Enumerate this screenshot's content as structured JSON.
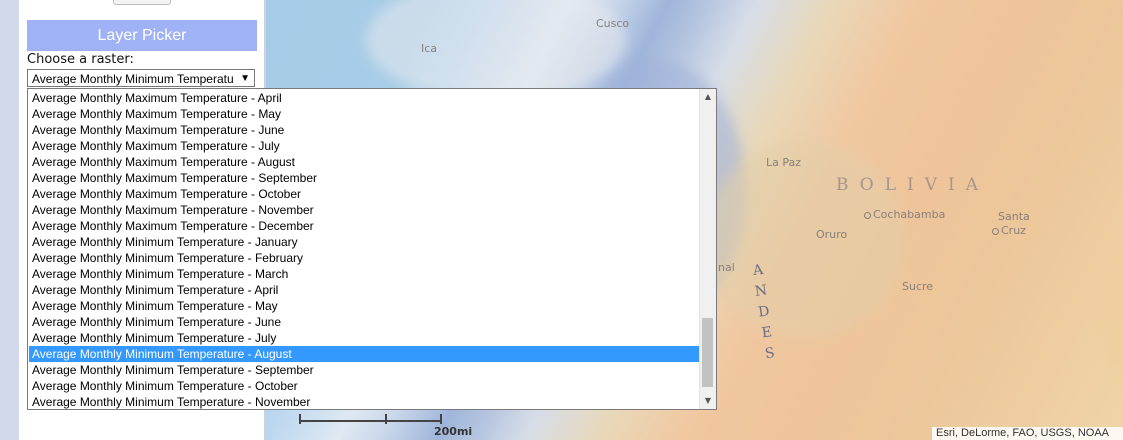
{
  "map": {
    "labels": {
      "country": "BOLIVIA",
      "range": "ANDES",
      "city_la_paz": "La Paz",
      "city_cochabamba": "Cochabamba",
      "city_oruro": "Oruro",
      "city_santa_cruz_line1": "Santa",
      "city_santa_cruz_line2": "Cruz",
      "city_sucre": "Sucre",
      "city_ica": "Ica",
      "city_cusco": "Cusco",
      "partial_nal": "nal"
    },
    "scale_label": "200mi",
    "attribution": "Esri, DeLorme, FAO, USGS, NOAA"
  },
  "panel": {
    "header": "Layer Picker",
    "choose_label": "Choose a raster:",
    "select_value": "Average Monthly Minimum Temperature - August",
    "select_arrow": "▼"
  },
  "dropdown": {
    "items": [
      "Average Monthly Maximum Temperature - April",
      "Average Monthly Maximum Temperature - May",
      "Average Monthly Maximum Temperature - June",
      "Average Monthly Maximum Temperature - July",
      "Average Monthly Maximum Temperature - August",
      "Average Monthly Maximum Temperature - September",
      "Average Monthly Maximum Temperature - October",
      "Average Monthly Maximum Temperature - November",
      "Average Monthly Maximum Temperature - December",
      "Average Monthly Minimum Temperature - January",
      "Average Monthly Minimum Temperature - February",
      "Average Monthly Minimum Temperature - March",
      "Average Monthly Minimum Temperature - April",
      "Average Monthly Minimum Temperature - May",
      "Average Monthly Minimum Temperature - June",
      "Average Monthly Minimum Temperature - July",
      "Average Monthly Minimum Temperature - August",
      "Average Monthly Minimum Temperature - September",
      "Average Monthly Minimum Temperature - October",
      "Average Monthly Minimum Temperature - November"
    ],
    "selected_index": 16,
    "scroll_up": "▲",
    "scroll_down": "▼"
  },
  "colors": {
    "header_bg": "#a0b2f6",
    "selection_bg": "#3399ff",
    "panel_edge": "#d2d9ea"
  }
}
